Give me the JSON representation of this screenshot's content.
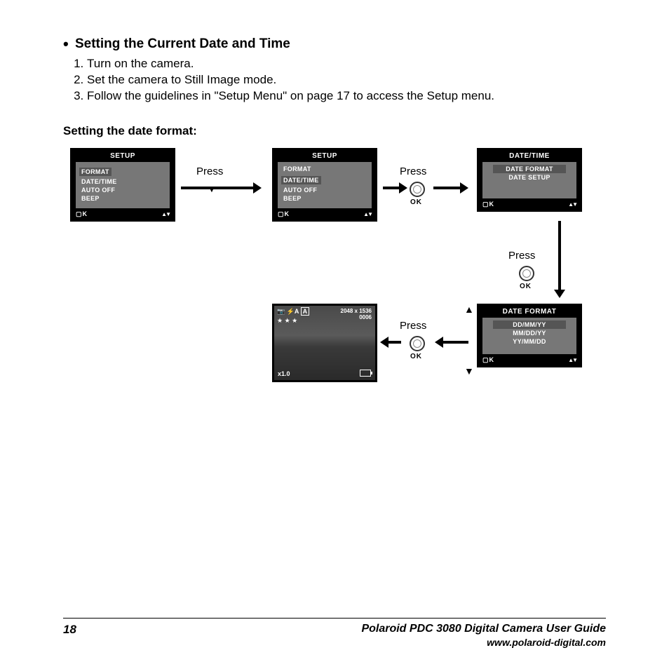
{
  "heading": "Setting the Current Date and Time",
  "steps": {
    "s1": "Turn on the camera.",
    "s2": "Set the camera to Still Image mode.",
    "s3": "Follow the guidelines in \"Setup Menu\" on page 17 to access the Setup menu."
  },
  "subheading": "Setting the date format:",
  "labels": {
    "press": "Press",
    "ok": "OK"
  },
  "screens": {
    "setup1": {
      "title": "SETUP",
      "items": [
        "FORMAT",
        "DATE/TIME",
        "AUTO OFF",
        "BEEP"
      ],
      "selected": "FORMAT"
    },
    "setup2": {
      "title": "SETUP",
      "items": [
        "FORMAT",
        "DATE/TIME",
        "AUTO OFF",
        "BEEP"
      ],
      "selected": "DATE/TIME"
    },
    "datetime": {
      "title": "DATE/TIME",
      "items": [
        "DATE FORMAT",
        "DATE SETUP"
      ],
      "selected": "DATE FORMAT"
    },
    "dateformat": {
      "title": "DATE FORMAT",
      "items": [
        "DD/MM/YY",
        "MM/DD/YY",
        "YY/MM/DD"
      ],
      "selected": "DD/MM/YY"
    },
    "photo": {
      "resolution": "2048 x 1536",
      "counter": "0006",
      "zoom": "x1.0",
      "stars": "★ ★ ★",
      "flash": "⚡A",
      "mode": "A"
    }
  },
  "footer": {
    "page": "18",
    "title": "Polaroid PDC 3080 Digital Camera User Guide",
    "url": "www.polaroid-digital.com"
  }
}
